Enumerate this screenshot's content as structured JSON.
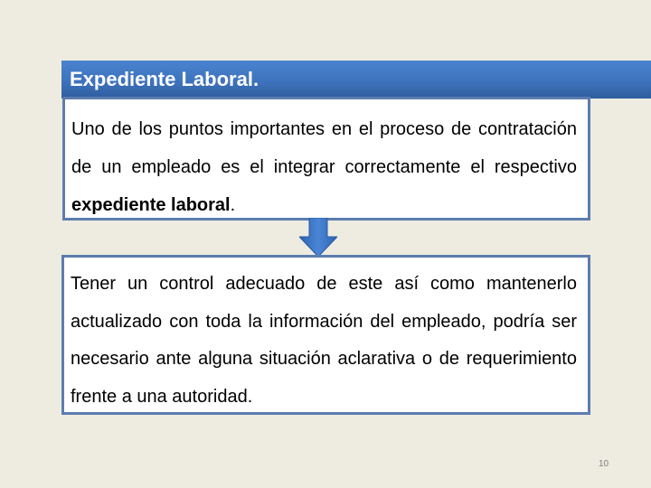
{
  "slide": {
    "title": "Expediente Laboral.",
    "page_number": "10",
    "colors": {
      "background": "#EEEBE1",
      "title_bar": "#3E73BD",
      "box_border": "#5C7DAF",
      "arrow": "#3A6FBF"
    }
  },
  "box1": {
    "text_before": "Uno de los puntos importantes en el proceso de contratación de un empleado es el integrar correctamente el respectivo ",
    "text_bold": "expediente laboral",
    "text_after": "."
  },
  "arrow": {
    "icon": "arrow-down-icon"
  },
  "box2": {
    "text": "Tener un control adecuado de este así como mantenerlo actualizado con toda la información del empleado, podría ser necesario ante alguna situación aclarativa o de requerimiento frente a una autoridad."
  }
}
